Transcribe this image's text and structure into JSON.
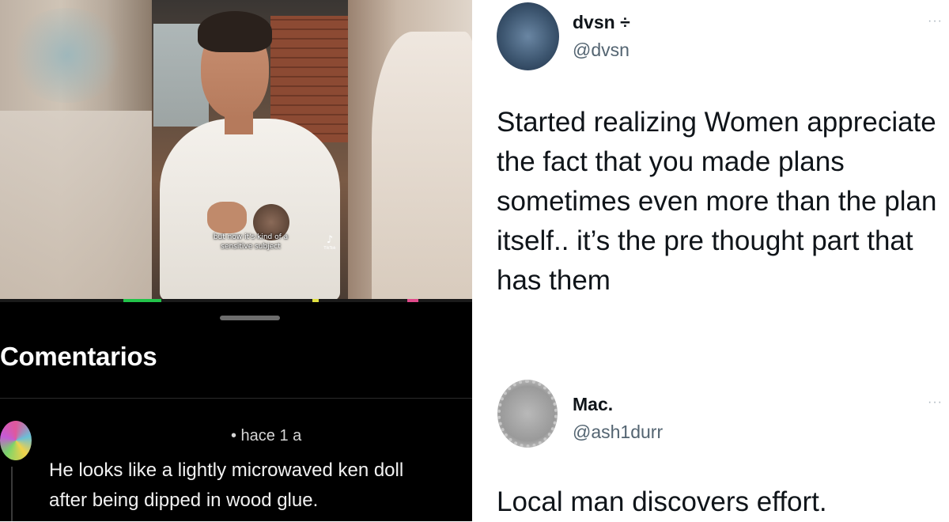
{
  "video": {
    "caption_line1": "but now it's kind of a",
    "caption_line2": "sensitive subject",
    "watermark": "♪",
    "watermark_label": "TikTok",
    "progress_colors": [
      "#22c34a",
      "#e0e040",
      "#e04a8a"
    ]
  },
  "comments": {
    "title": "Comentarios",
    "items": [
      {
        "time": "• hace 1 a",
        "line1": "He looks like a lightly microwaved ken doll",
        "line2": "after being dipped in wood glue."
      }
    ]
  },
  "tweets": [
    {
      "name": "dvsn ÷",
      "handle": "@dvsn",
      "more": "···",
      "lines": [
        "Started realizing Women appreciate",
        "the fact that you made plans",
        "sometimes even more than the plan",
        "itself.. it’s the pre thought part that",
        "has them"
      ]
    },
    {
      "name": "Mac.",
      "handle": "@ash1durr",
      "more": "···",
      "lines": [
        "Local man discovers effort."
      ]
    }
  ]
}
